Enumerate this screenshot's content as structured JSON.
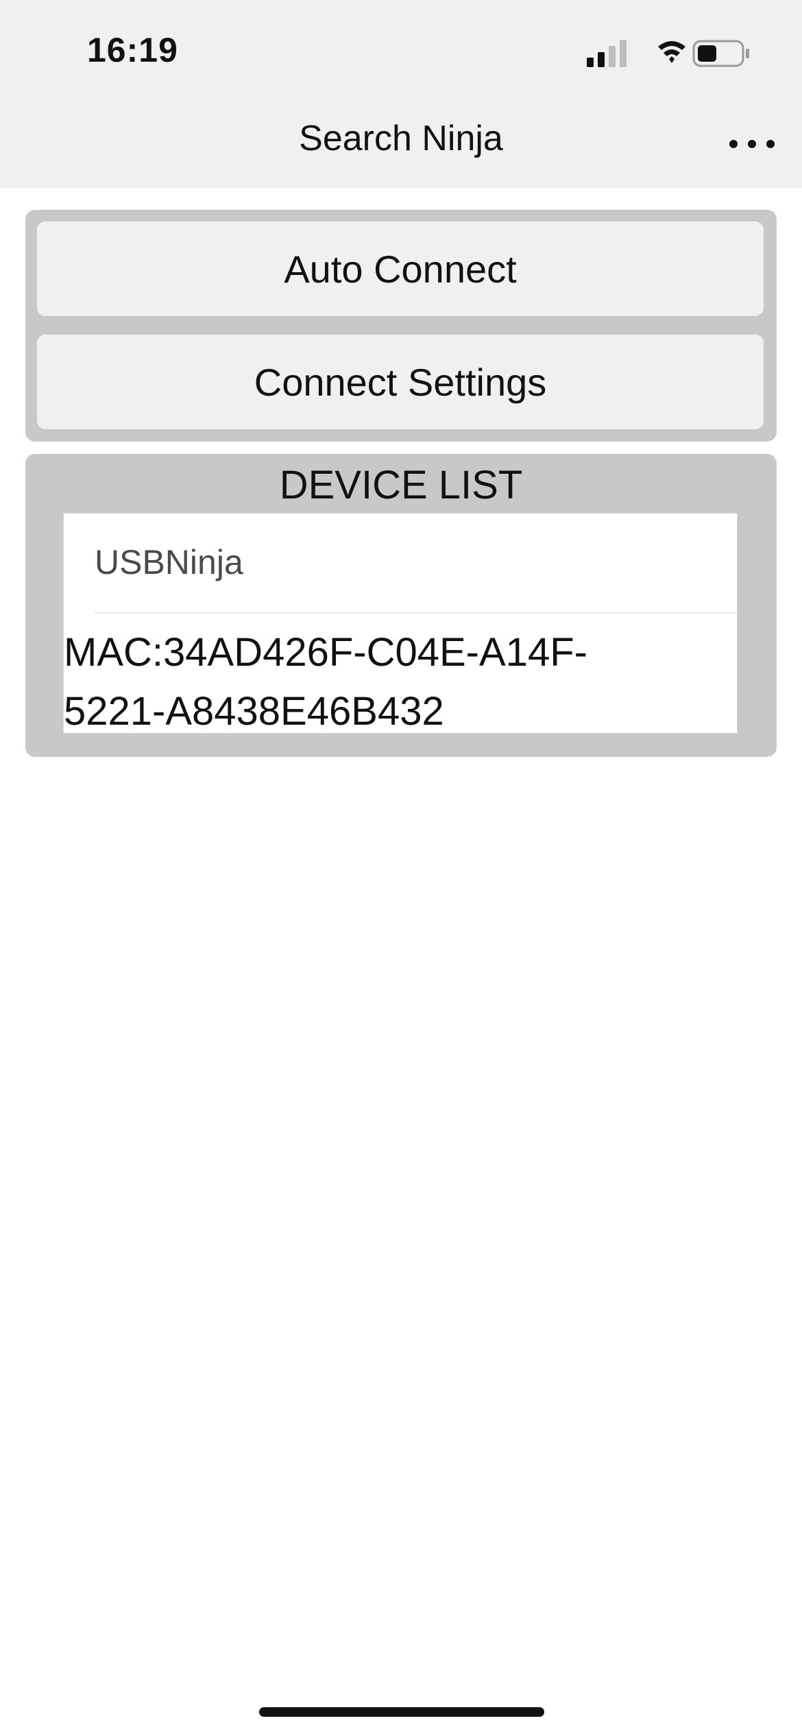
{
  "status_bar": {
    "time": "16:19",
    "icons": [
      "cellular-signal-icon",
      "wifi-icon",
      "battery-icon"
    ],
    "battery_level": 0.45
  },
  "nav": {
    "title": "Search Ninja",
    "more_icon": "more-horizontal-icon"
  },
  "actions": {
    "auto_connect_label": "Auto Connect",
    "connect_settings_label": "Connect Settings"
  },
  "device_list": {
    "title": "DEVICE LIST",
    "devices": [
      {
        "name": "USBNinja",
        "mac": "MAC:34AD426F-C04E-A14F-5221-A8438E46B432"
      }
    ]
  },
  "colors": {
    "bar_background": "#f0f0f0",
    "panel_background": "#c8c8cb",
    "button_background": "#f0f0f0",
    "text": "#111111"
  }
}
